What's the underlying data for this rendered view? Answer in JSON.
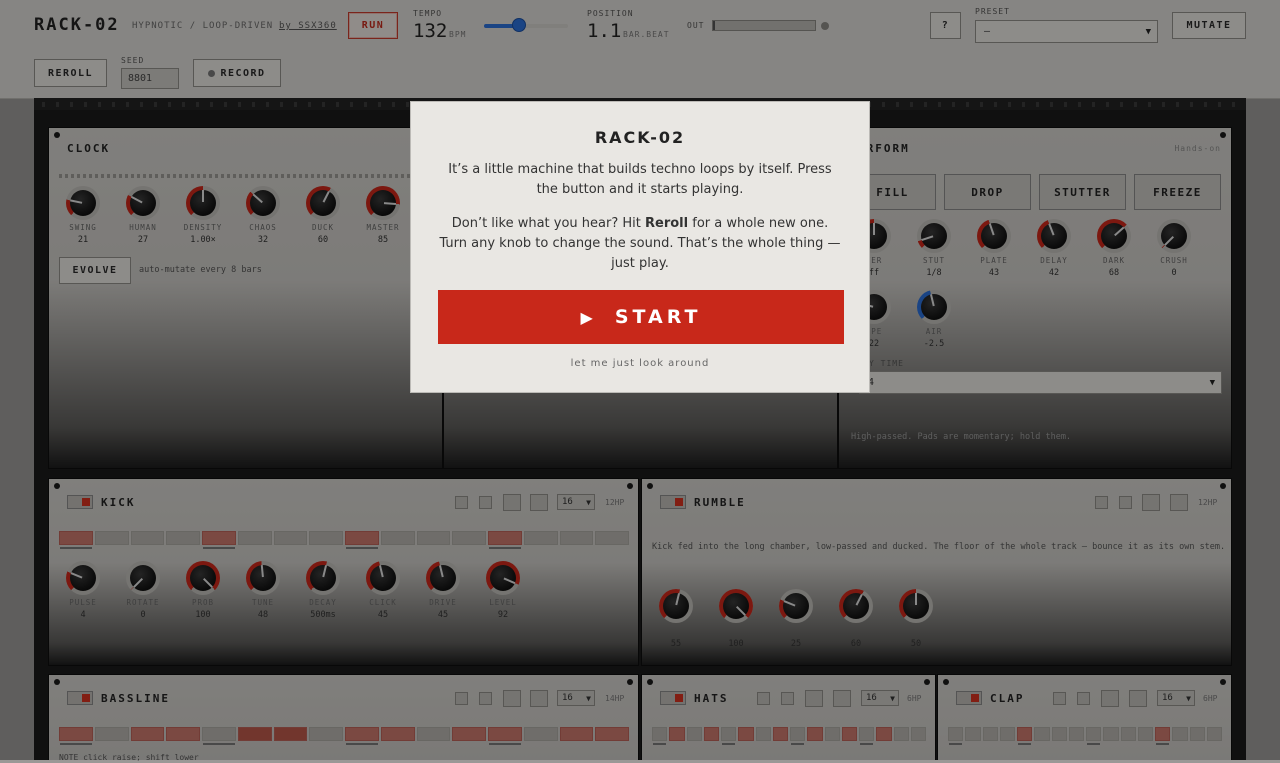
{
  "header": {
    "brand": "RACK-02",
    "tagline": "HYPNOTIC / LOOP-DRIVEN",
    "byline": "by SSX360",
    "run_label": "RUN",
    "tempo_label": "TEMPO",
    "tempo_value": "132",
    "tempo_unit": "BPM",
    "tempo_slider_level": 0.42,
    "position_label": "POSITION",
    "position_value": "1.1",
    "position_unit": "BAR.BEAT",
    "out_label": "OUT",
    "help_label": "?",
    "preset_label": "PRESET",
    "preset_value": "–",
    "mutate_label": "MUTATE",
    "reroll_label": "REROLL",
    "seed_label": "SEED",
    "seed_value": "8801",
    "record_label": "RECORD"
  },
  "clock": {
    "title": "CLOCK",
    "knobs": [
      {
        "label": "SWING",
        "value": "21",
        "level": 0.21
      },
      {
        "label": "HUMAN",
        "value": "27",
        "level": 0.27
      },
      {
        "label": "DENSITY",
        "value": "1.00×",
        "level": 0.5
      },
      {
        "label": "CHAOS",
        "value": "32",
        "level": 0.32
      },
      {
        "label": "DUCK",
        "value": "60",
        "level": 0.6
      },
      {
        "label": "MASTER",
        "value": "85",
        "level": 0.85
      }
    ],
    "evolve_label": "EVOLVE",
    "evolve_note": "auto-mutate every 8 bars"
  },
  "perform": {
    "title_visible": "ERFORM",
    "subtitle": "Hands-on",
    "buttons": [
      "FILL",
      "DROP",
      "STUTTER",
      "FREEZE"
    ],
    "knobs_row1": [
      {
        "label": "TER",
        "value": "ff",
        "level": 0.5
      },
      {
        "label": "STUT",
        "value": "1/8",
        "level": 0.1
      },
      {
        "label": "PLATE",
        "value": "43",
        "level": 0.43
      },
      {
        "label": "DELAY",
        "value": "42",
        "level": 0.42
      },
      {
        "label": "DARK",
        "value": "68",
        "level": 0.68
      },
      {
        "label": "CRUSH",
        "value": "0",
        "level": 0.0
      }
    ],
    "knobs_row2": [
      {
        "label": "APE",
        "value": "22",
        "level": 0.22
      },
      {
        "label": "AIR",
        "value": "-2.5",
        "level": 0.45
      }
    ],
    "select_label": "Y TIME",
    "select_value": "4",
    "note": "High-passed. Pads are momentary; hold them."
  },
  "kick": {
    "title": "KICK",
    "steps_select": "16",
    "hp": "12HP",
    "steps": [
      1,
      0,
      0,
      0,
      1,
      0,
      0,
      0,
      1,
      0,
      0,
      0,
      1,
      0,
      0,
      0
    ],
    "knobs": [
      {
        "label": "PULSE",
        "value": "4",
        "level": 0.25
      },
      {
        "label": "ROTATE",
        "value": "0",
        "level": 0.0
      },
      {
        "label": "PROB",
        "value": "100",
        "level": 1.0
      },
      {
        "label": "TUNE",
        "value": "48",
        "level": 0.48
      },
      {
        "label": "DECAY",
        "value": "500ms",
        "level": 0.55
      },
      {
        "label": "CLICK",
        "value": "45",
        "level": 0.45
      },
      {
        "label": "DRIVE",
        "value": "45",
        "level": 0.45
      },
      {
        "label": "LEVEL",
        "value": "92",
        "level": 0.92
      }
    ]
  },
  "rumble": {
    "title": "RUMBLE",
    "hp": "12HP",
    "description": "Kick fed into the long chamber, low-passed and ducked. The floor of the whole track — bounce it as its own stem.",
    "knobs": [
      {
        "label": "",
        "value": "55",
        "level": 0.55
      },
      {
        "label": "",
        "value": "100",
        "level": 1.0
      },
      {
        "label": "",
        "value": "25",
        "level": 0.25
      },
      {
        "label": "",
        "value": "60",
        "level": 0.6
      },
      {
        "label": "",
        "value": "50",
        "level": 0.5
      }
    ]
  },
  "bassline": {
    "title": "BASSLINE",
    "steps_select": "16",
    "hp": "14HP",
    "steps": [
      1,
      0,
      1,
      1,
      0,
      2,
      2,
      0,
      1,
      1,
      0,
      1,
      1,
      0,
      1,
      1
    ],
    "note": "NOTE click raise; shift lower"
  },
  "hats": {
    "title": "HATS",
    "steps_select": "16",
    "hp": "6HP",
    "steps": [
      0,
      1,
      0,
      1,
      0,
      1,
      0,
      1,
      0,
      1,
      0,
      1,
      0,
      1,
      0,
      0
    ]
  },
  "clap": {
    "title": "CLAP",
    "steps_select": "16",
    "hp": "6HP",
    "steps": [
      0,
      0,
      0,
      0,
      1,
      0,
      0,
      0,
      0,
      0,
      0,
      0,
      1,
      0,
      0,
      0
    ]
  },
  "modal": {
    "title": "RACK-02",
    "p1": "It’s a little machine that builds techno loops by itself. Press the button and it starts playing.",
    "p2_a": "Don’t like what you hear? Hit ",
    "p2_b": "Reroll",
    "p2_c": " for a whole new one. Turn any knob to change the sound. That’s the whole thing — just play.",
    "start_label": "START",
    "look_label": "let me just look around"
  },
  "colors": {
    "accent": "#c8281a",
    "slider": "#2a6fd6"
  }
}
